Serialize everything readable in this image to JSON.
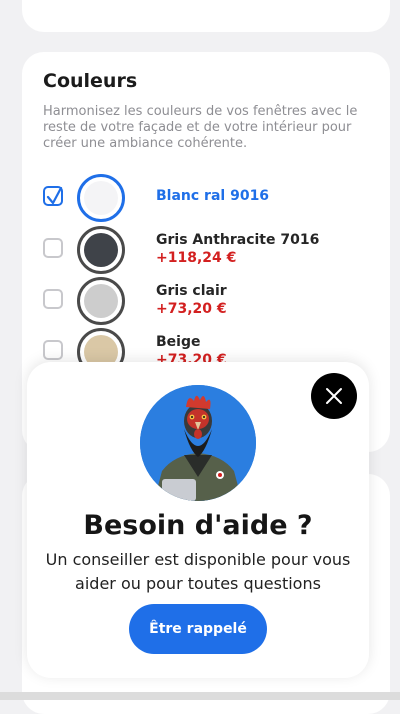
{
  "colors_section": {
    "title": "Couleurs",
    "description": "Harmonisez les couleurs de vos fenêtres avec le reste de votre façade et de votre intérieur pour créer une ambiance cohérente.",
    "options": [
      {
        "name": "Blanc ral 9016",
        "price": "",
        "swatch_color": "#f4f4f6",
        "selected": true
      },
      {
        "name": "Gris Anthracite 7016",
        "price": "+118,24 €",
        "swatch_color": "#3f4349",
        "selected": false
      },
      {
        "name": "Gris clair",
        "price": "+73,20 €",
        "swatch_color": "#cdcdcd",
        "selected": false
      },
      {
        "name": "Beige",
        "price": "+73,20 €",
        "swatch_color": "#dac8a6",
        "selected": false
      }
    ]
  },
  "help_modal": {
    "title": "Besoin d'aide ?",
    "text": "Un conseiller est disponible pour vous aider ou pour toutes questions",
    "button_label": "Être rappelé"
  },
  "colors": {
    "accent": "#1f6fe8",
    "price": "#d32020",
    "avatar_bg": "#2b7ee0"
  },
  "icons": [
    "checkmark-icon",
    "close-icon"
  ]
}
